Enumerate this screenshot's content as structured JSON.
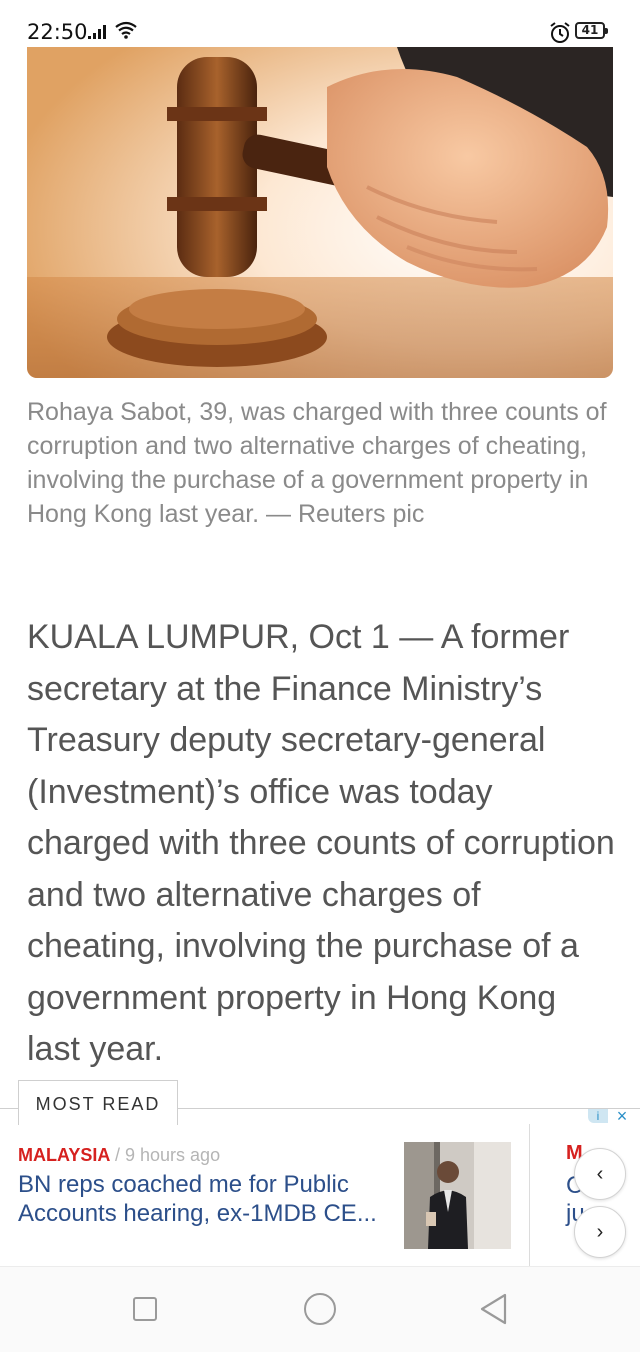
{
  "status_bar": {
    "time": "22:50",
    "battery": "41",
    "icons": [
      "signal-icon",
      "wifi-icon",
      "alarm-icon",
      "battery-icon"
    ]
  },
  "article": {
    "caption": "Rohaya Sabot, 39, was charged with three counts of corruption and two alternative charges of cheating, involving the purchase of a government property in Hong Kong last year. — Reuters pic",
    "body": "KUALA LUMPUR, Oct 1 — A former secretary at the Finance Ministry’s Treasury deputy secretary-general (Investment)’s office was today charged with three counts of corruption and two alternative charges of cheating, involving the purchase of a government property in Hong Kong last year."
  },
  "most_read": {
    "tab_label": "MOST READ",
    "cards": [
      {
        "category": "MALAYSIA",
        "meta": "/ 9 hours ago",
        "title": "BN reps coached me for Public Accounts hearing, ex-1MDB CE..."
      }
    ],
    "peek": {
      "line1": "M",
      "line2": "C",
      "line3": "ju"
    },
    "prev_icon": "‹",
    "next_icon": "›",
    "ad_info_icon": "i",
    "ad_close_icon": "×"
  },
  "colors": {
    "category_red": "#d6211f",
    "title_blue": "#2c4f8a",
    "caption_gray": "#8a8a8a",
    "body_gray": "#555555"
  }
}
